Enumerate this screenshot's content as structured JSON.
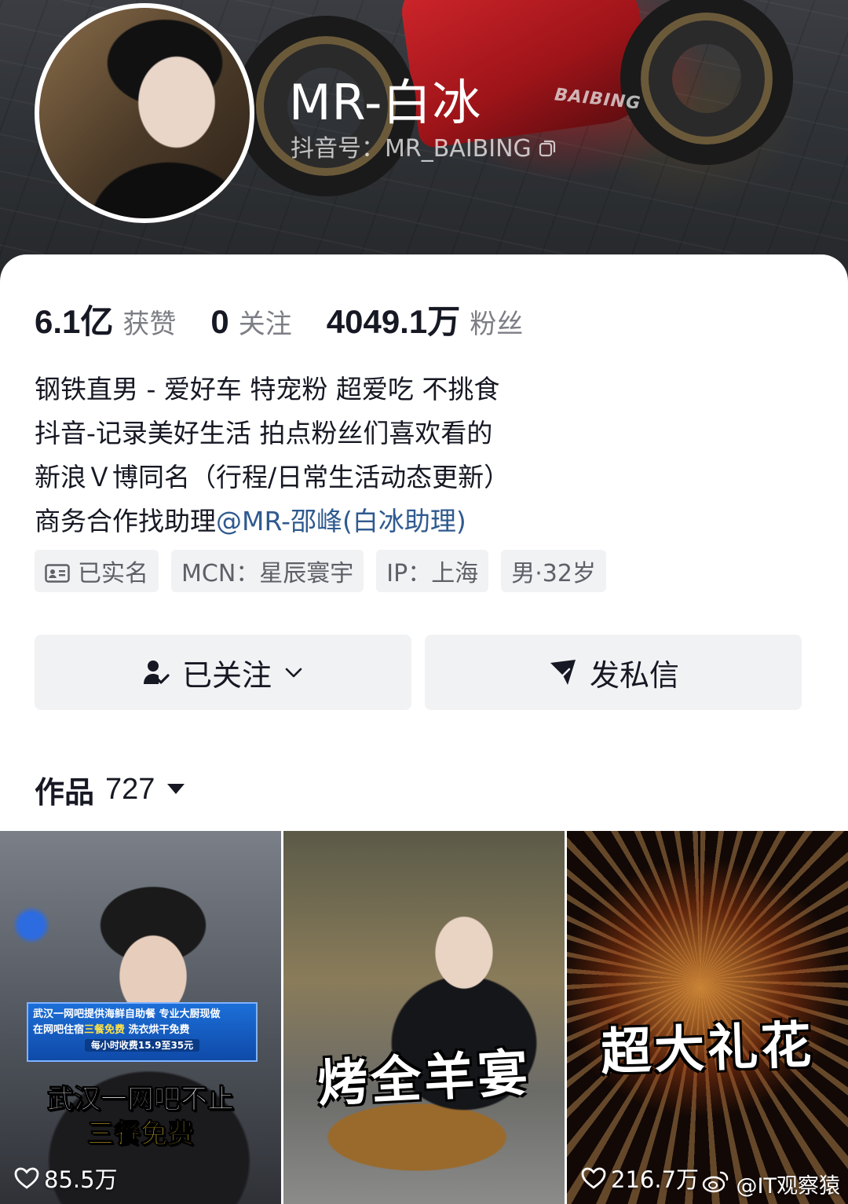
{
  "profile": {
    "nickname": "MR-白冰",
    "douyin_id": "抖音号：MR_BAIBING",
    "banner_brand": "BAIBING"
  },
  "stats": [
    {
      "value": "6.1亿",
      "label": "获赞"
    },
    {
      "value": "0",
      "label": "关注"
    },
    {
      "value": "4049.1万",
      "label": "粉丝"
    }
  ],
  "bio": {
    "line1": "钢铁直男 - 爱好车 特宠粉 超爱吃 不挑食",
    "line2": "抖音-记录美好生活 拍点粉丝们喜欢看的",
    "line3": "新浪Ｖ博同名（行程/日常生活动态更新）",
    "line4_prefix": "商务合作找助理",
    "line4_mention": "@MR-邵峰(白冰助理)"
  },
  "tags": {
    "verified": "已实名",
    "mcn": "MCN：星辰寰宇",
    "ip": "IP：上海",
    "gender_age": "男·32岁"
  },
  "actions": {
    "follow_label": "已关注",
    "message_label": "发私信"
  },
  "works": {
    "title": "作品",
    "count": "727"
  },
  "videos": [
    {
      "news_line1_a": "武汉一网吧提供海鲜自助餐",
      "news_line1_b": " 专业大厨现做",
      "news_line2_a": "在网吧住宿",
      "news_line2_hl": "三餐免费",
      "news_line2_b": " 洗衣烘干免费",
      "news_pill": "每小时收费15.9至35元",
      "caption_a": "武汉一网吧不止",
      "caption_b": "三餐免费",
      "likes": "85.5万"
    },
    {
      "caption": "烤全羊宴",
      "likes": ""
    },
    {
      "caption": "超大礼花",
      "likes": "216.7万"
    }
  ],
  "watermark": "@IT观察猿",
  "colors": {
    "mention": "#2f5a8f",
    "tag_bg": "#f1f2f4",
    "button_bg": "#f1f2f4",
    "secondary_text": "#7d7e85"
  }
}
